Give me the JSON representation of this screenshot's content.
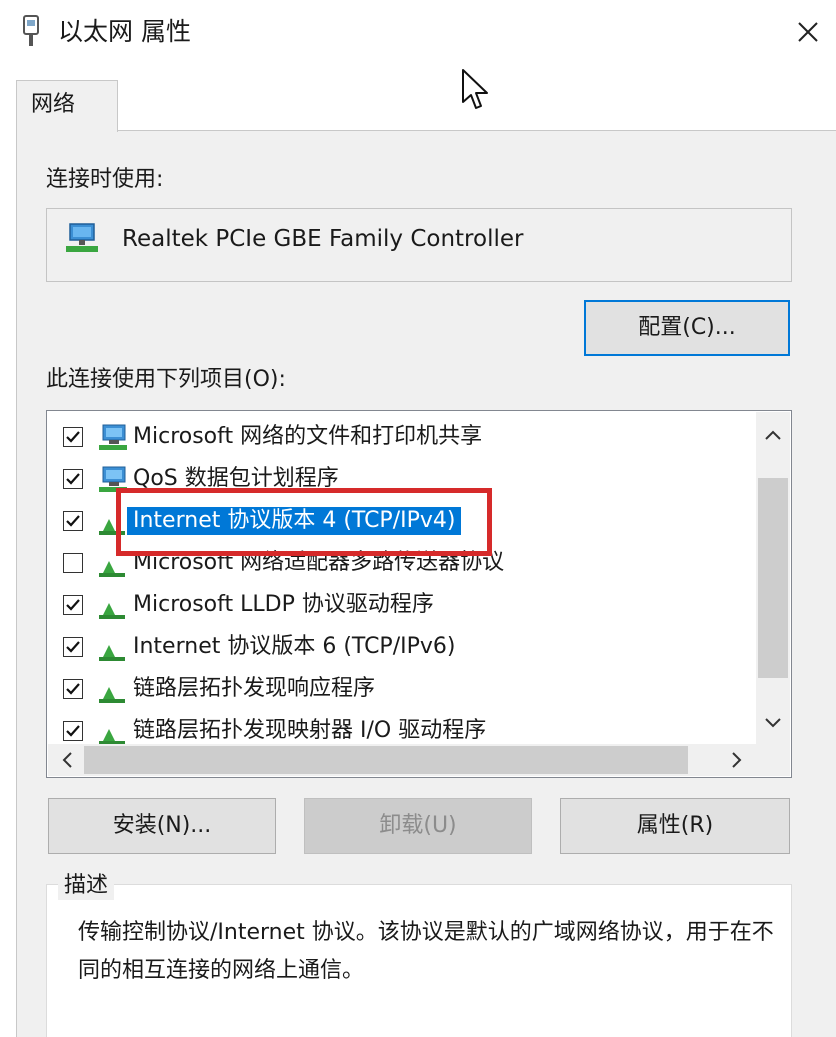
{
  "window": {
    "title": "以太网 属性",
    "close_label": "×"
  },
  "tabs": [
    {
      "label": "网络"
    }
  ],
  "connect_using": {
    "label": "连接时使用:",
    "adapter_name": "Realtek PCIe GBE Family Controller",
    "configure_button": "配置(C)..."
  },
  "items_section": {
    "label": "此连接使用下列项目(O):",
    "items": [
      {
        "label": "Microsoft 网络的文件和打印机共享",
        "checked": true,
        "icon": "network-share-icon"
      },
      {
        "label": "QoS 数据包计划程序",
        "checked": true,
        "icon": "network-share-icon"
      },
      {
        "label": "Internet 协议版本 4 (TCP/IPv4)",
        "checked": true,
        "icon": "protocol-icon",
        "selected": true
      },
      {
        "label": "Microsoft 网络适配器多路传送器协议",
        "checked": false,
        "icon": "protocol-icon"
      },
      {
        "label": "Microsoft LLDP 协议驱动程序",
        "checked": true,
        "icon": "protocol-icon"
      },
      {
        "label": "Internet 协议版本 6 (TCP/IPv6)",
        "checked": true,
        "icon": "protocol-icon"
      },
      {
        "label": "链路层拓扑发现响应程序",
        "checked": true,
        "icon": "protocol-icon"
      },
      {
        "label": "链路层拓扑发现映射器 I/O 驱动程序",
        "checked": true,
        "icon": "protocol-icon"
      }
    ]
  },
  "buttons": {
    "install": "安装(N)...",
    "uninstall": "卸载(U)",
    "properties": "属性(R)"
  },
  "description": {
    "title": "描述",
    "text": "传输控制协议/Internet 协议。该协议是默认的广域网络协议，用于在不同的相互连接的网络上通信。"
  },
  "colors": {
    "selection": "#0078d7",
    "highlight_border": "#d62a2a"
  }
}
